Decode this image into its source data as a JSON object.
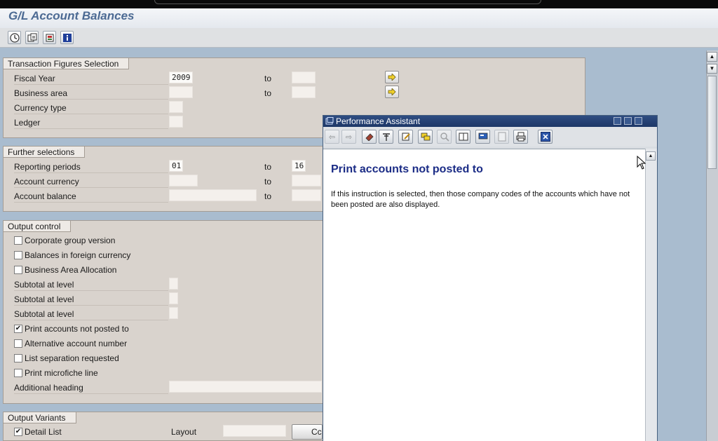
{
  "header": {
    "title": "G/L Account Balances"
  },
  "toolbar": {
    "buttons": [
      {
        "icon": "execute-clock-icon"
      },
      {
        "icon": "get-variant-icon"
      },
      {
        "icon": "selection-options-icon"
      },
      {
        "icon": "info-icon"
      }
    ]
  },
  "transaction_figures": {
    "title": "Transaction Figures Selection",
    "to_label": "to",
    "fiscal_year": {
      "label": "Fiscal Year",
      "value": "2009",
      "to_value": ""
    },
    "business_area": {
      "label": "Business area",
      "value": "",
      "to_value": ""
    },
    "currency_type": {
      "label": "Currency type",
      "value": ""
    },
    "ledger": {
      "label": "Ledger",
      "value": ""
    }
  },
  "further_selections": {
    "title": "Further selections",
    "to_label": "to",
    "reporting_periods": {
      "label": "Reporting periods",
      "value": "01",
      "to_value": "16"
    },
    "account_currency": {
      "label": "Account currency",
      "value": "",
      "to_value": ""
    },
    "account_balance": {
      "label": "Account balance",
      "value": "",
      "to_value": ""
    }
  },
  "output_control": {
    "title": "Output control",
    "corporate_group_version": {
      "label": "Corporate group version",
      "checked": false
    },
    "balances_foreign_currency": {
      "label": "Balances in foreign currency",
      "checked": false
    },
    "business_area_allocation": {
      "label": "Business Area Allocation",
      "checked": false
    },
    "subtotal_1": {
      "label": "Subtotal at level",
      "value": ""
    },
    "subtotal_2": {
      "label": "Subtotal at level",
      "value": ""
    },
    "subtotal_3": {
      "label": "Subtotal at level",
      "value": ""
    },
    "print_accounts_not_posted": {
      "label": "Print accounts not posted to",
      "checked": true,
      "mark": "✔"
    },
    "alternative_account_number": {
      "label": "Alternative account number",
      "checked": false
    },
    "list_separation": {
      "label": "List separation requested",
      "checked": false
    },
    "print_microfiche": {
      "label": "Print microfiche line",
      "checked": false
    },
    "additional_heading": {
      "label": "Additional heading",
      "value": ""
    }
  },
  "output_variants": {
    "title": "Output Variants",
    "detail_list": {
      "label": "Detail List",
      "checked": true,
      "mark": "✔"
    },
    "layout_label": "Layout",
    "layout_value": "",
    "button_partial": "Cc"
  },
  "performance_assistant": {
    "window_title": "Performance Assistant",
    "heading": "Print accounts not posted to",
    "text": "If this instruction is selected, then those company codes of the accounts which have not been posted are also displayed."
  },
  "colors": {
    "title_text": "#4c6a93",
    "pa_header": "#1d3767",
    "pa_heading": "#1b2c86",
    "group_bg": "#d9d3cd",
    "background": "#a9bccf"
  }
}
